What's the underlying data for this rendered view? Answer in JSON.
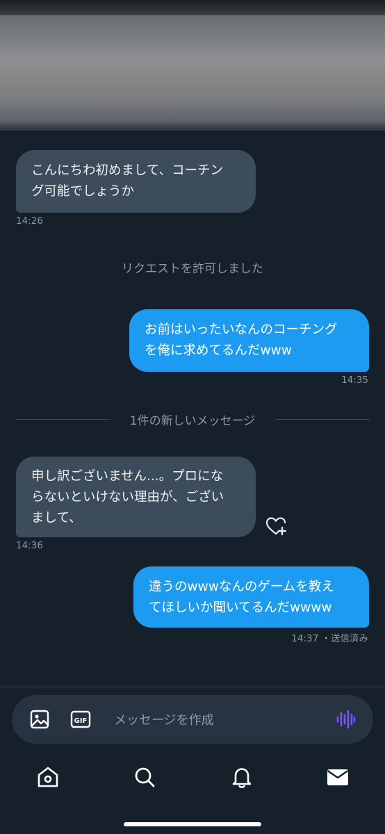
{
  "messages": [
    {
      "text": "こんにちわ初めまして、コーチン\nグ可能でしょうか",
      "time": "14:26"
    },
    {
      "system": "リクエストを許可しました"
    },
    {
      "text": "お前はいったいなんのコーチング\nを俺に求めてるんだwww",
      "time": "14:35"
    },
    {
      "divider": "1件の新しいメッセージ"
    },
    {
      "text": "申し訳ございません...。プロにな\nらないといけない理由が、ござい\nまして、",
      "time": "14:36"
    },
    {
      "text": "違うのwwwなんのゲームを教え\nてほしいか聞いてるんだwwww",
      "time": "14:37",
      "status": "・送信済み"
    }
  ],
  "composer": {
    "placeholder": "メッセージを作成"
  },
  "icons": {
    "image": "image-icon",
    "gif": "gif-icon",
    "voice": "voice-icon",
    "home": "home-icon",
    "search": "search-icon",
    "notifications": "bell-icon",
    "messages": "mail-icon",
    "reaction": "heart-plus-icon"
  },
  "colors": {
    "background": "#15202b",
    "incoming_bubble": "#3d4c5b",
    "outgoing_bubble": "#1d9bf0",
    "voice_accent": "#7856ff"
  }
}
